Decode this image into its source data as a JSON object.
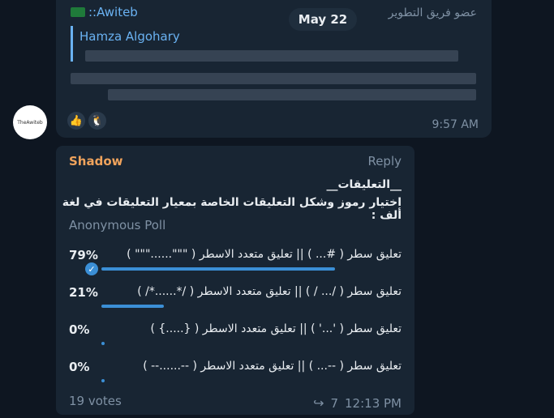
{
  "message1": {
    "sender": "::Awiteb",
    "role": "عضو فريق التطوير",
    "reply_to": "Hamza Algohary",
    "time": "9:57 AM",
    "date": "May 22"
  },
  "reactions": [
    "👍",
    "🐧"
  ],
  "avatar_text": "TheAwiteb",
  "message2": {
    "sender": "Shadow",
    "reply_label": "Reply",
    "title": "__التعليقات__",
    "question": "اختيار رموز وشكل التعليقات الخاصة بمعيار التعليقات في لغة ألف :",
    "poll_type": "Anonymous Poll",
    "options": [
      {
        "text": "تعليق سطر ( #... ) || تعليق متعدد الاسطر ( \"\"\"......\"\"\" )",
        "percent": "79%",
        "fraction": 0.79,
        "chosen": true
      },
      {
        "text": "تعليق سطر ( /... / ) || تعليق متعدد الاسطر ( /*......*/ )",
        "percent": "21%",
        "fraction": 0.21,
        "chosen": false
      },
      {
        "text": "تعليق سطر ( '...' ) || تعليق متعدد الاسطر ( {.....} )",
        "percent": "0%",
        "fraction": 0,
        "chosen": false
      },
      {
        "text": "تعليق سطر ( --... ) || تعليق متعدد الاسطر ( --......-- )",
        "percent": "0%",
        "fraction": 0,
        "chosen": false
      }
    ],
    "votes": "19 votes",
    "forwards": "7",
    "time": "12:13 PM"
  }
}
